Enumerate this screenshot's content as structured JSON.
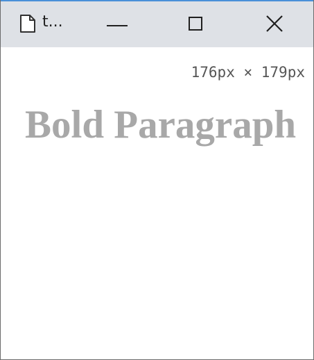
{
  "window": {
    "tab_title": "t...",
    "icons": {
      "page": "page-icon",
      "minimize": "minimize-icon",
      "maximize": "maximize-icon",
      "close": "close-icon"
    },
    "colors": {
      "titlebar": "#dee1e6",
      "accent_line": "#4a90d9"
    }
  },
  "viewport": {
    "size_readout": "176px × 179px",
    "paragraph": "Bold Paragraph",
    "colors": {
      "paragraph_text": "#a8a8a8",
      "readout_text": "#555555"
    }
  }
}
